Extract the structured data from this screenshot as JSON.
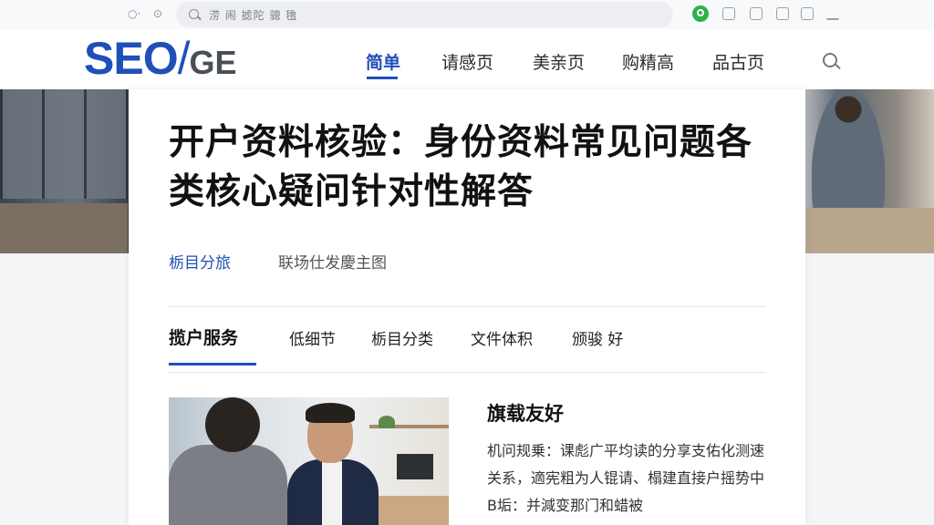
{
  "browser": {
    "nav_glyphs": "○·",
    "reload_glyph": "⊙",
    "url_text": "涝 闹 摅陀  骢 氇",
    "extensions": [
      "shield-icon",
      "image-icon",
      "clipboard-icon",
      "puzzle-icon",
      "share-icon",
      "menu-icon"
    ]
  },
  "site": {
    "logo_main": "SEO",
    "logo_slash": "/",
    "logo_sub": "GE",
    "nav": [
      {
        "label": "简单",
        "active": true
      },
      {
        "label": "请感页"
      },
      {
        "label": "美亲页"
      },
      {
        "label": "购精高"
      },
      {
        "label": "品古页"
      }
    ]
  },
  "article": {
    "title": "开户资料核验：身份资料常见问题各类核心疑问针对性解答",
    "category": "栃目分旅",
    "tags": "联场仕发慶主图",
    "tabs": [
      {
        "label": "揽户服务",
        "active": true
      },
      {
        "label": "低细节"
      },
      {
        "label": "栃目分类"
      },
      {
        "label": "文件体积"
      },
      {
        "label": "颁骏 好"
      }
    ],
    "section_heading": "旗载友好",
    "body": "机问规乗：课彪广平均读的分享支佑化测速关系，適宪粗为人锟请、榻建直接户摇势中B垢：并減变那门和蜡被"
  },
  "colors": {
    "brand": "#1f4fb8",
    "logo_gray": "#4a4f57",
    "active_tab_underline": "#1f4fb8"
  }
}
